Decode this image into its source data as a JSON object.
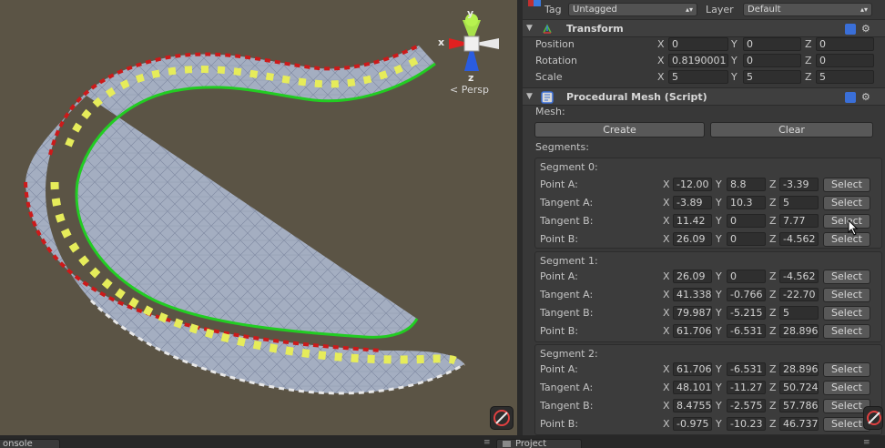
{
  "scene": {
    "gizmo": {
      "x_label": "x",
      "y_label": "y",
      "z_label": "z",
      "view_mode": "Persp"
    }
  },
  "inspector": {
    "tag_label": "Tag",
    "tag_value": "Untagged",
    "layer_label": "Layer",
    "layer_value": "Default",
    "transform": {
      "title": "Transform",
      "rows": [
        {
          "label": "Position",
          "x": "0",
          "y": "0",
          "z": "0"
        },
        {
          "label": "Rotation",
          "x": "0.8190001",
          "y": "0",
          "z": "0"
        },
        {
          "label": "Scale",
          "x": "5",
          "y": "5",
          "z": "5"
        }
      ]
    },
    "procedural_mesh": {
      "title": "Procedural Mesh (Script)",
      "mesh_label": "Mesh:",
      "create_label": "Create",
      "clear_label": "Clear",
      "segments_label": "Segments:",
      "select_label": "Select",
      "axis_x": "X",
      "axis_y": "Y",
      "axis_z": "Z",
      "segments": [
        {
          "title": "Segment 0:",
          "rows": [
            {
              "label": "Point A:",
              "x": "-12.00",
              "y": "8.8",
              "z": "-3.39"
            },
            {
              "label": "Tangent A:",
              "x": "-3.89",
              "y": "10.3",
              "z": "5"
            },
            {
              "label": "Tangent B:",
              "x": "11.42",
              "y": "0",
              "z": "7.77"
            },
            {
              "label": "Point B:",
              "x": "26.09",
              "y": "0",
              "z": "-4.562"
            }
          ]
        },
        {
          "title": "Segment 1:",
          "rows": [
            {
              "label": "Point A:",
              "x": "26.09",
              "y": "0",
              "z": "-4.562"
            },
            {
              "label": "Tangent A:",
              "x": "41.338",
              "y": "-0.766",
              "z": "-22.70"
            },
            {
              "label": "Tangent B:",
              "x": "79.987",
              "y": "-5.215",
              "z": "5"
            },
            {
              "label": "Point B:",
              "x": "61.706",
              "y": "-6.531",
              "z": "28.896"
            }
          ]
        },
        {
          "title": "Segment 2:",
          "rows": [
            {
              "label": "Point A:",
              "x": "61.706",
              "y": "-6.531",
              "z": "28.896"
            },
            {
              "label": "Tangent A:",
              "x": "48.101",
              "y": "-11.27",
              "z": "50.724"
            },
            {
              "label": "Tangent B:",
              "x": "8.4755",
              "y": "-2.575",
              "z": "57.786"
            },
            {
              "label": "Point B:",
              "x": "-0.975",
              "y": "-10.23",
              "z": "46.737"
            }
          ]
        }
      ]
    }
  },
  "bottom_tabs": {
    "console": "onsole",
    "project": "Project"
  },
  "colors": {
    "scene_bg": "#5b5445",
    "road": "#a9b4c8",
    "curb_red": "#cc1a1a",
    "marker_yellow": "#e6ec5a",
    "spline_green": "#22cc22"
  }
}
